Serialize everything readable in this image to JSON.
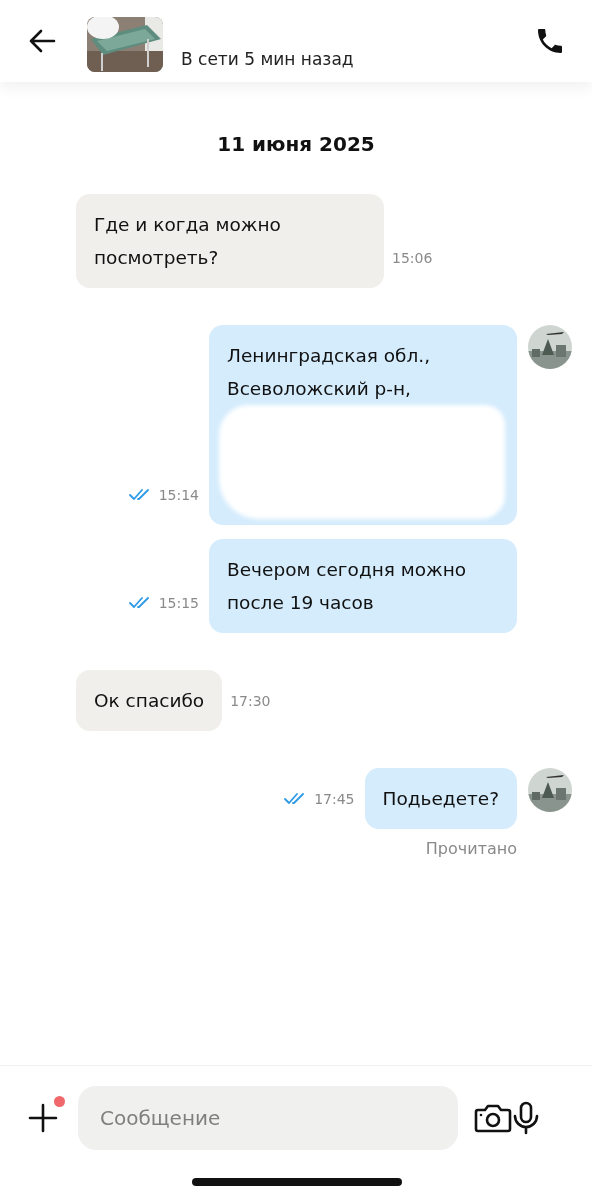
{
  "header": {
    "status": "В сети 5 мин назад"
  },
  "date": "11 июня 2025",
  "messages": [
    {
      "kind": "incoming",
      "text": "Где и когда можно посмотреть?",
      "time": "15:06",
      "redacted": false
    },
    {
      "kind": "outgoing",
      "text": "Ленинградская обл., Всеволожский р-н,",
      "time": "15:14",
      "read": true,
      "avatar": true,
      "redacted": true
    },
    {
      "kind": "outgoing",
      "text": "Вечером сегодня можно после 19 часов",
      "time": "15:15",
      "read": true,
      "avatar": false,
      "redacted": false
    },
    {
      "kind": "incoming",
      "text": "Ок спасибо",
      "time": "17:30",
      "redacted": false
    },
    {
      "kind": "outgoing",
      "text": "Подьедете?",
      "time": "17:45",
      "read": true,
      "avatar": true,
      "redacted": false
    }
  ],
  "read_status": "Прочитано",
  "composer": {
    "placeholder": "Сообщение",
    "attach_badge": true
  }
}
